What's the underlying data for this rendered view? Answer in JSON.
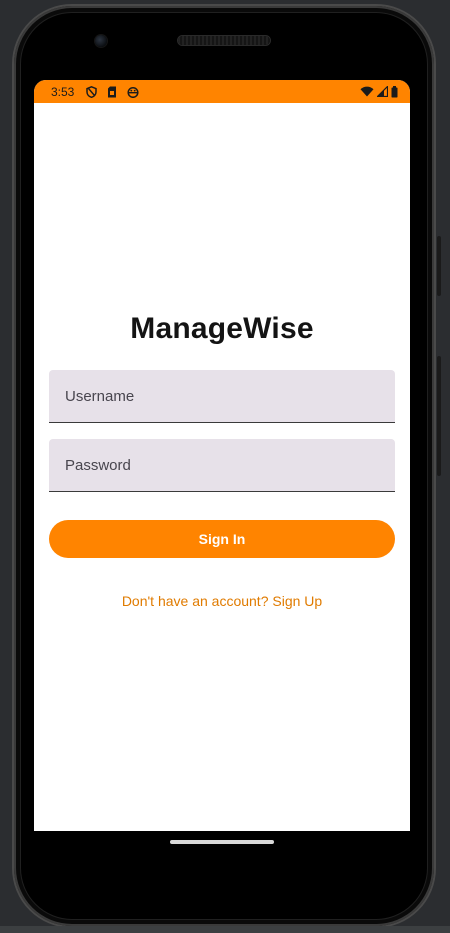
{
  "status_bar": {
    "time": "3:53",
    "left_icons": [
      "shield-icon",
      "sim-card-icon",
      "android-face-icon"
    ],
    "right_icons": [
      "wifi-icon",
      "cell-signal-icon",
      "battery-icon"
    ],
    "accent": "#ff8400"
  },
  "app": {
    "title": "ManageWise"
  },
  "form": {
    "username_placeholder": "Username",
    "password_placeholder": "Password",
    "username_value": "",
    "password_value": "",
    "signin_label": "Sign In",
    "signup_link": "Don't have an account? Sign Up"
  },
  "colors": {
    "primary": "#ff8400",
    "field_background": "#e7e1e9",
    "link": "#e07b00"
  }
}
